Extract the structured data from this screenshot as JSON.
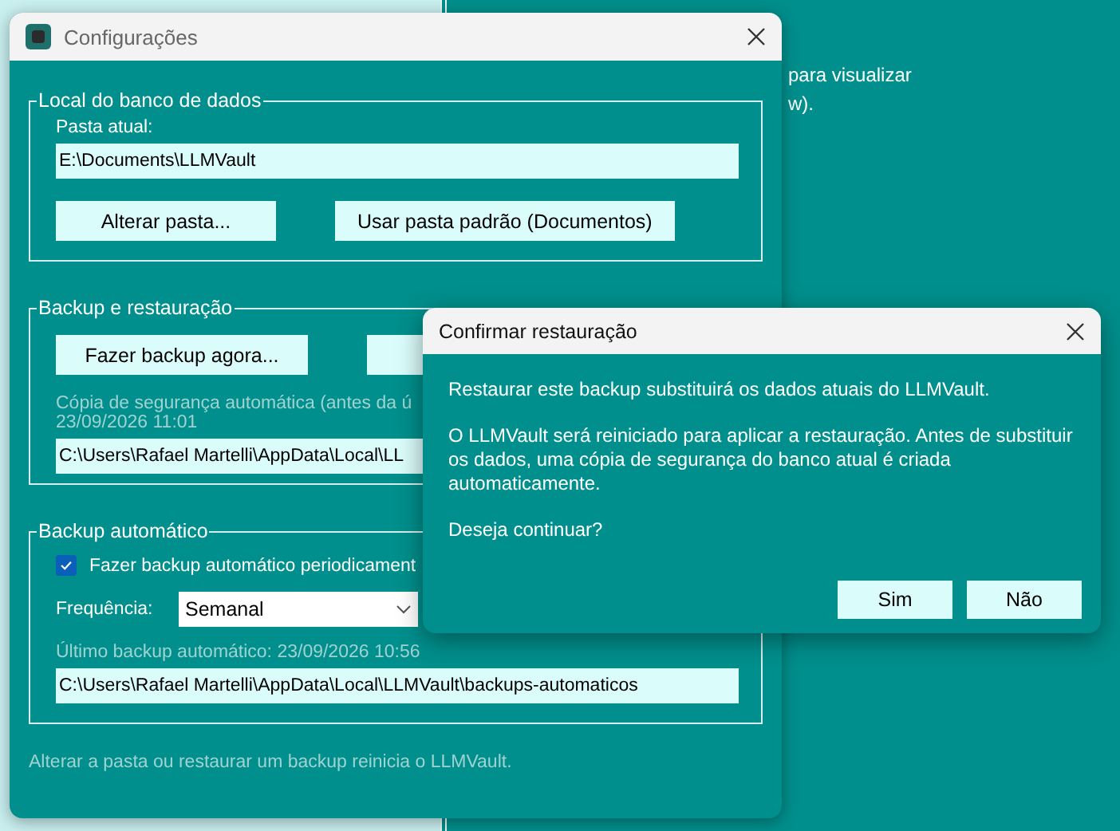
{
  "background_window": {
    "lines": [
      "para visualizar",
      "w)."
    ]
  },
  "settings_window": {
    "title": "Configurações",
    "database_location": {
      "title": "Local do banco de dados",
      "current_folder_label": "Pasta atual:",
      "current_folder_value": "E:\\Documents\\LLMVault",
      "buttons": [
        "Alterar pasta...",
        "Usar pasta padrão (Documentos)"
      ]
    },
    "backup_restore": {
      "title": "Backup e restauração",
      "buttons": [
        "Fazer backup agora..."
      ],
      "auto_copy_note": "Cópia de segurança automática (antes da ú",
      "auto_copy_time": "23/09/2026 11:01",
      "path_value": "C:\\Users\\Rafael Martelli\\AppData\\Local\\LL"
    },
    "auto_backup": {
      "title": "Backup automático",
      "checkbox": {
        "label": "Fazer backup automático periodicament",
        "checked": true
      },
      "frequency_label": "Frequência:",
      "frequency_value": "Semanal",
      "last_backup": "Último backup automático: 23/09/2026 10:56",
      "path_value": "C:\\Users\\Rafael Martelli\\AppData\\Local\\LLMVault\\backups-automaticos"
    },
    "footer": "Alterar a pasta ou restaurar um backup reinicia o LLMVault."
  },
  "dialog": {
    "title": "Confirmar restauração",
    "paragraphs": [
      "Restaurar este backup substituirá os dados atuais do LLMVault.",
      "O LLMVault será reiniciado para aplicar a restauração. Antes de substituir os dados, uma cópia de segurança do banco atual é criada automaticamente.",
      "Deseja continuar?"
    ],
    "buttons": [
      "Sim",
      "Não"
    ]
  }
}
